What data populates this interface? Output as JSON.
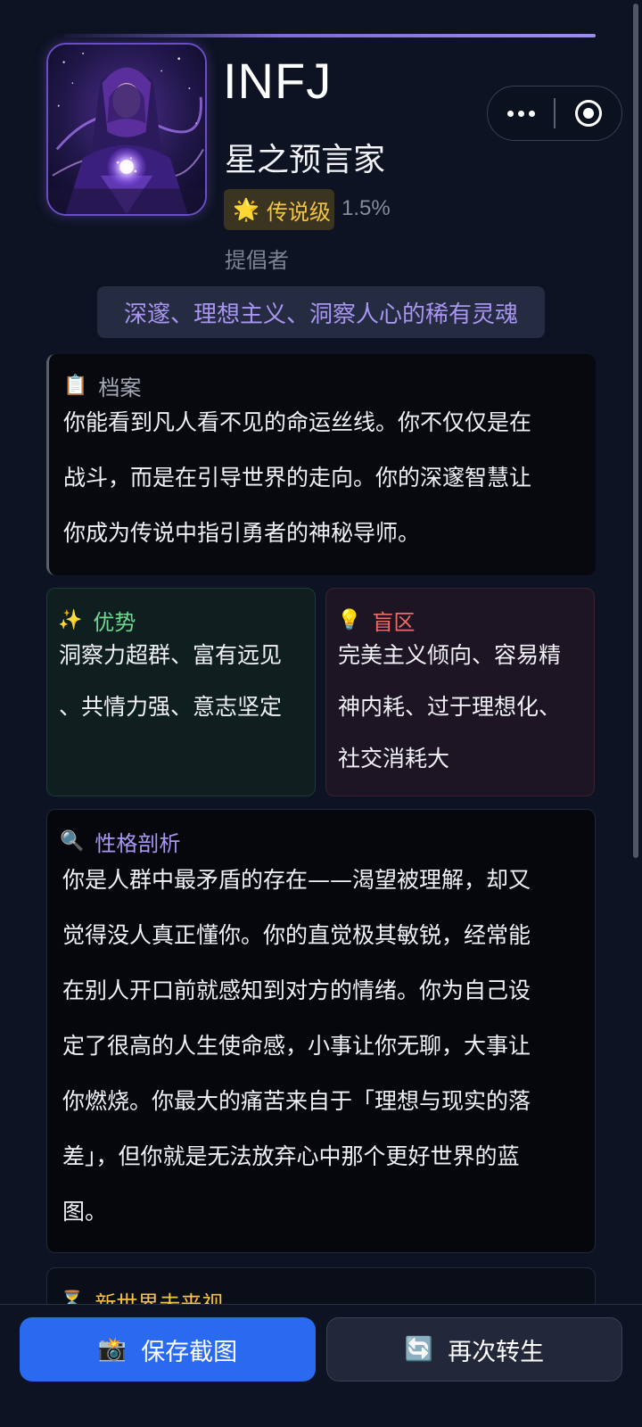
{
  "header": {
    "type_code": "INFJ",
    "type_title": "星之预言家",
    "rarity_icon": "sun-icon",
    "rarity_label": "传说级",
    "rarity_percent": "1.5%",
    "role_name": "提倡者",
    "tagline": "深邃、理想主义、洞察人心的稀有灵魂"
  },
  "capsule": {
    "more_icon": "more-dots-icon",
    "close_icon": "target-icon"
  },
  "profile": {
    "icon": "clipboard-icon",
    "title": "档案",
    "lines": [
      "你能看到凡人看不见的命运丝线。你不仅仅是在",
      "战斗，而是在引导世界的走向。你的深邃智慧让",
      "你成为传说中指引勇者的神秘导师。"
    ]
  },
  "strengths": {
    "icon": "sparkles-icon",
    "title": "优势",
    "color": "#6fd98f",
    "lines": [
      "洞察力超群、富有远见",
      "、共情力强、意志坚定"
    ]
  },
  "blind_spots": {
    "icon": "lightbulb-icon",
    "title": "盲区",
    "color": "#f06a6a",
    "lines": [
      "完美主义倾向、容易精",
      "神内耗、过于理想化、",
      "社交消耗大"
    ]
  },
  "analysis": {
    "icon": "magnifier-icon",
    "title": "性格剖析",
    "color": "#a896f0",
    "lines": [
      "你是人群中最矛盾的存在——渴望被理解，却又",
      "觉得没人真正懂你。你的直觉极其敏锐，经常能",
      "在别人开口前就感知到对方的情绪。你为自己设",
      "定了很高的人生使命感，小事让你无聊，大事让",
      "你燃烧。你最大的痛苦来自于「理想与现实的落",
      "差」，但你就是无法放弃心中那个更好世界的蓝",
      "图。"
    ]
  },
  "future": {
    "icon": "hourglass-icon",
    "title": "新世界未来视"
  },
  "actions": {
    "save_icon": "camera-icon",
    "save_label": "保存截图",
    "reborn_icon": "refresh-icon",
    "reborn_label": "再次转生"
  },
  "colors": {
    "accent": "#2a6af0",
    "legendary": "#f4c545",
    "tagline": "#a896f0"
  }
}
